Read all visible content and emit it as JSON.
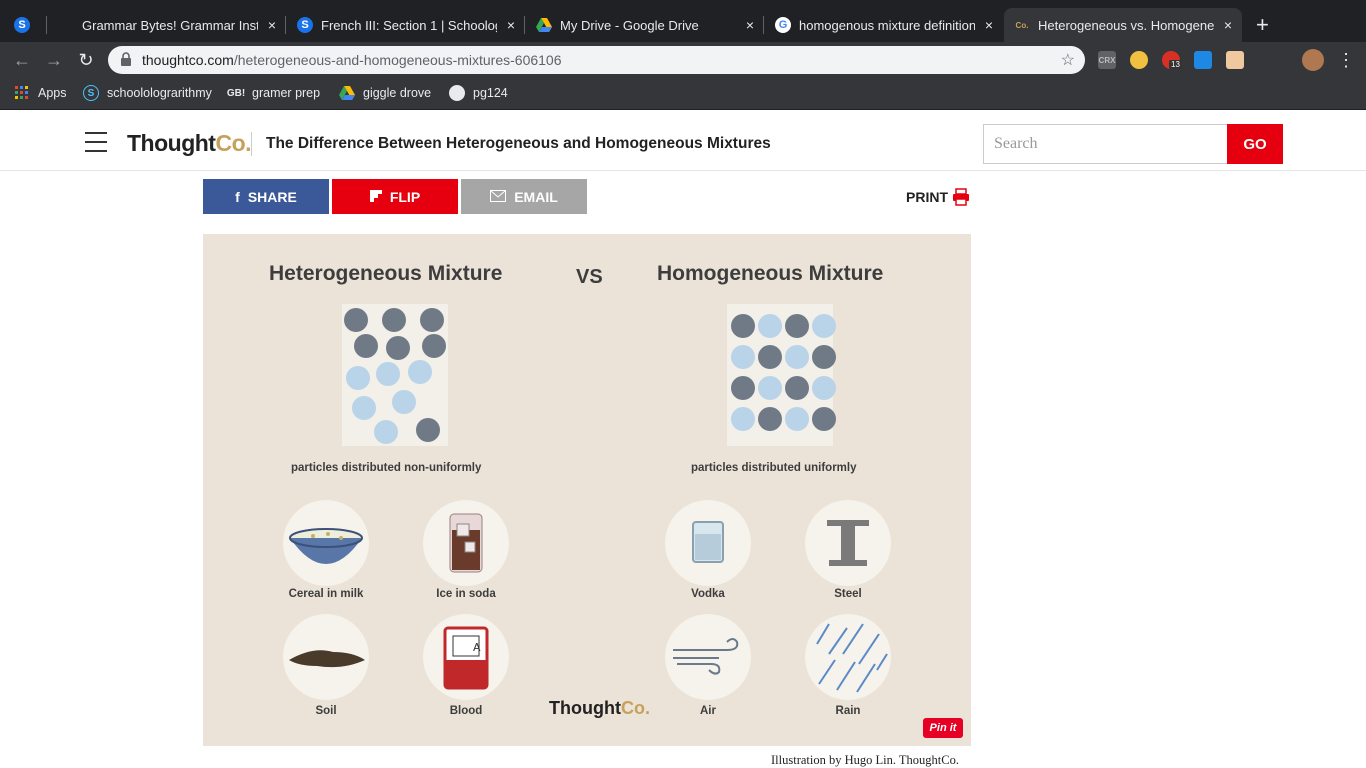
{
  "browser": {
    "tabs": [
      {
        "title": "Grammar Bytes! Grammar Instr",
        "close": "×"
      },
      {
        "title": "French III: Section 1 | Schoolog",
        "close": "×"
      },
      {
        "title": "My Drive - Google Drive",
        "close": "×"
      },
      {
        "title": "homogenous mixture definition",
        "close": "×"
      },
      {
        "title": "Heterogeneous vs. Homogene",
        "close": "×"
      }
    ],
    "new_tab": "+",
    "url_domain": "thoughtco.com",
    "url_path": "/heterogeneous-and-homogeneous-mixtures-606106",
    "ext_badge": "13",
    "bookmarks": [
      {
        "label": "Apps",
        "icon": "apps-grid-icon"
      },
      {
        "label": "schoololograrithmy",
        "icon": "schoology-icon"
      },
      {
        "label": "gramer prep",
        "icon": "gb-icon"
      },
      {
        "label": "giggle drove",
        "icon": "google-drive-icon"
      },
      {
        "label": "pg124",
        "icon": "globe-icon"
      }
    ]
  },
  "site": {
    "logo_main": "Thought",
    "logo_co": "Co.",
    "headline": "The Difference Between Heterogeneous and Homogeneous Mixtures",
    "search_placeholder": "Search",
    "go_label": "GO",
    "share_label": "SHARE",
    "flip_label": "FLIP",
    "email_label": "EMAIL",
    "print_label": "PRINT",
    "share_color": "#3b5998",
    "flip_color": "#e6000f",
    "email_color": "#a6a6a6"
  },
  "infographic": {
    "left_title": "Heterogeneous Mixture",
    "vs": "VS",
    "right_title": "Homogeneous Mixture",
    "left_caption": "particles distributed non-uniformly",
    "right_caption": "particles distributed uniformly",
    "examples_left": [
      "Cereal in milk",
      "Ice in soda",
      "Soil",
      "Blood"
    ],
    "examples_right": [
      "Vodka",
      "Steel",
      "Air",
      "Rain"
    ],
    "blood_bag_letter": "A",
    "logo_main": "Thought",
    "logo_co": "Co.",
    "pin_label": "Pin it",
    "dark_dot_color": "#707a86",
    "light_dot_color": "#b9d3e8"
  },
  "credit": "Illustration by Hugo Lin. ThoughtCo."
}
